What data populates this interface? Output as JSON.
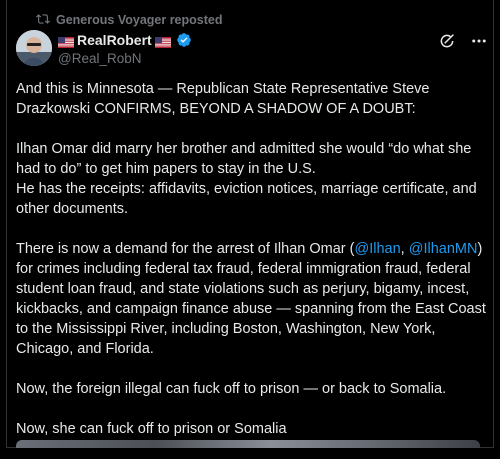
{
  "repost": {
    "text": "Generous Voyager reposted",
    "icon": "repost-icon"
  },
  "author": {
    "name": "RealRobert",
    "handle": "@Real_RobN",
    "verified": true,
    "avatar": "avatar-photo"
  },
  "actions": {
    "grok_icon": "grok-icon",
    "more_icon": "more-icon"
  },
  "post": {
    "p1": "And this is Minnesota — Republican State Representative Steve Drazkowski CONFIRMS, BEYOND A SHADOW OF A DOUBT:",
    "p2a": "Ilhan Omar did marry her brother and admitted she would “do what she had to do” to get him papers to stay in the U.S.",
    "p2b": "He has the receipts: affidavits, eviction notices, marriage certificate, and other documents.",
    "p3_start": "There is now a demand for the arrest of Ilhan Omar (",
    "mention1": "@Ilhan",
    "p3_sep": ", ",
    "mention2": "@IlhanMN",
    "p3_end": ") for crimes including federal tax fraud, federal immigration fraud, federal student loan fraud, and state violations such as perjury, bigamy, incest, kickbacks, and campaign finance abuse — spanning from the East Coast to the Mississippi River, including Boston, Washington, New York, Chicago, and Florida.",
    "p4": "Now, the foreign illegal can fuck off to prison — or back to Somalia.",
    "p5": "Now, she can fuck off to prison or Somalia"
  },
  "colors": {
    "accent": "#1d9bf0",
    "text": "#e7e9ea",
    "muted": "#71767b",
    "background": "#000000"
  }
}
